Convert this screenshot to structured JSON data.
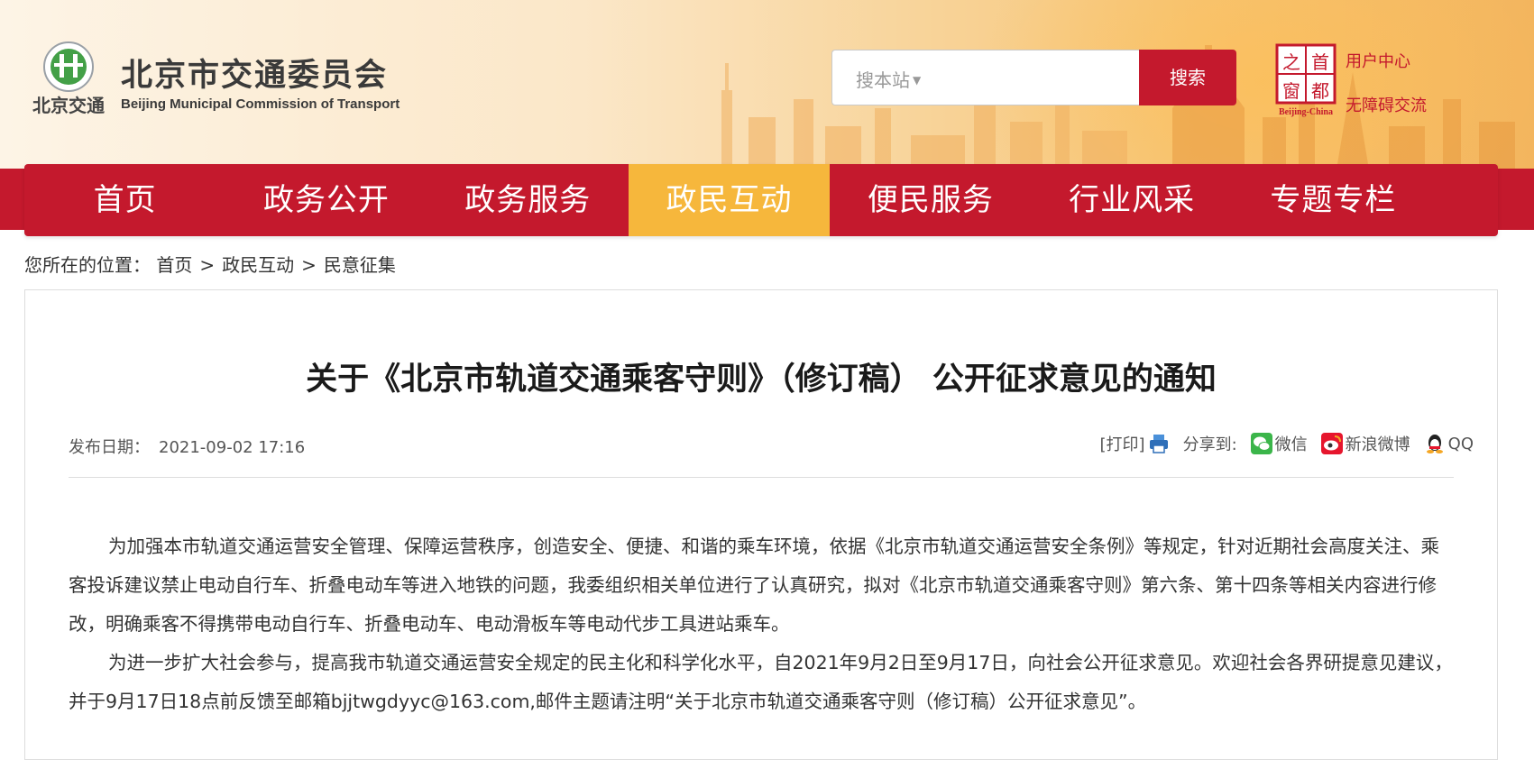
{
  "site": {
    "title": "北京市交通委员会",
    "subtitle": "Beijing Municipal Commission of Transport",
    "logo_text": "北京交通",
    "logo_icon": "beijing-transport-logo-icon"
  },
  "search": {
    "scope_label": "搜本站",
    "button_label": "搜索"
  },
  "header_links": {
    "capital_window_logo": "首都之窗 Beijing-China",
    "user_center": "用户中心",
    "accessibility": "无障碍交流"
  },
  "nav": {
    "items": [
      {
        "label": "首页",
        "active": false
      },
      {
        "label": "政务公开",
        "active": false
      },
      {
        "label": "政务服务",
        "active": false
      },
      {
        "label": "政民互动",
        "active": true
      },
      {
        "label": "便民服务",
        "active": false
      },
      {
        "label": "行业风采",
        "active": false
      },
      {
        "label": "专题专栏",
        "active": false
      }
    ]
  },
  "breadcrumb": {
    "prefix": "您所在的位置：",
    "items": [
      "首页",
      "政民互动",
      "民意征集"
    ],
    "separator": ">"
  },
  "article": {
    "title": "关于《北京市轨道交通乘客守则》（修订稿） 公开征求意见的通知",
    "publish_label": "发布日期：",
    "publish_date": "2021-09-02 17:16",
    "print_label": "[打印]",
    "share_label": "分享到:",
    "share_targets": [
      "微信",
      "新浪微博",
      "QQ"
    ],
    "paragraphs": [
      "为加强本市轨道交通运营安全管理、保障运营秩序，创造安全、便捷、和谐的乘车环境，依据《北京市轨道交通运营安全条例》等规定，针对近期社会高度关注、乘客投诉建议禁止电动自行车、折叠电动车等进入地铁的问题，我委组织相关单位进行了认真研究，拟对《北京市轨道交通乘客守则》第六条、第十四条等相关内容进行修改，明确乘客不得携带电动自行车、折叠电动车、电动滑板车等电动代步工具进站乘车。",
      "为进一步扩大社会参与，提高我市轨道交通运营安全规定的民主化和科学化水平，自2021年9月2日至9月17日，向社会公开征求意见。欢迎社会各界研提意见建议，并于9月17日18点前反馈至邮箱bjjtwgdyyc@163.com,邮件主题请注明“关于北京市轨道交通乘客守则（修订稿）公开征求意见”。"
    ]
  },
  "colors": {
    "brand_red": "#c4192d",
    "active_nav": "#f6b73c",
    "title_text": "#1a1a1a"
  }
}
